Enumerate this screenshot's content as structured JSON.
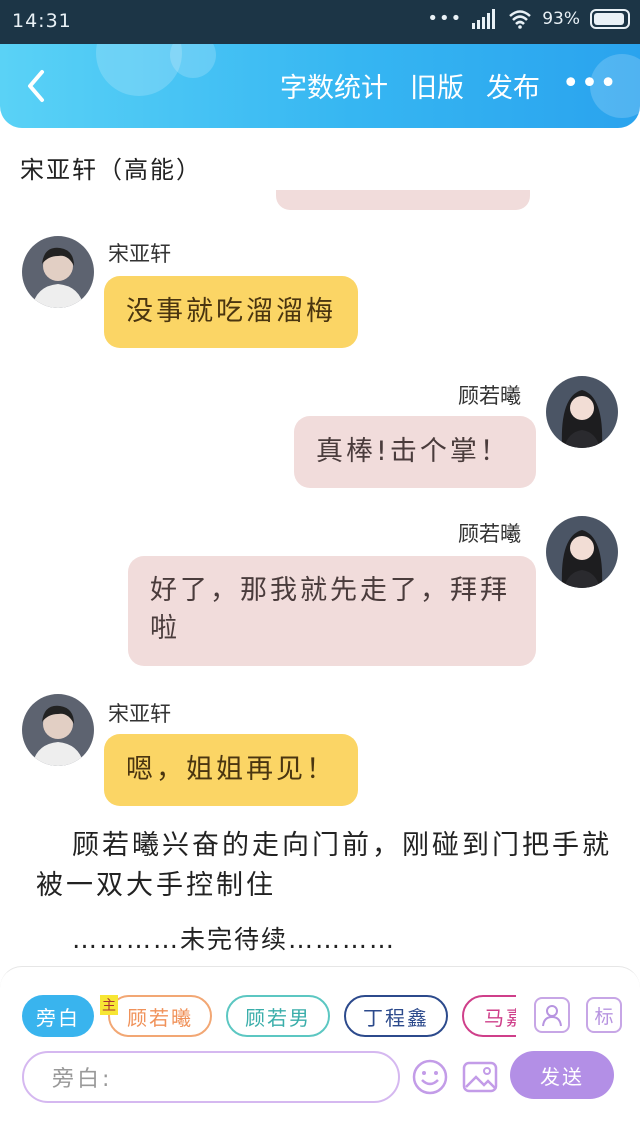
{
  "status_bar": {
    "time": "14:31",
    "battery": "93%",
    "battery_level": 0.93
  },
  "header": {
    "actions": [
      "字数统计",
      "旧版",
      "发布"
    ],
    "more": "•••"
  },
  "story_title": "宋亚轩（高能）",
  "messages": [
    {
      "side": "left",
      "name": "宋亚轩",
      "text": "没事就吃溜溜梅"
    },
    {
      "side": "right",
      "name": "顾若曦",
      "text": "真棒!击个掌！"
    },
    {
      "side": "right",
      "name": "顾若曦",
      "text": "好了，那我就先走了，拜拜啦"
    },
    {
      "side": "left",
      "name": "宋亚轩",
      "text": "嗯，姐姐再见！"
    }
  ],
  "narration": "顾若曦兴奋的走向门前，刚碰到门把手就被一双大手控制住",
  "to_be_continued": "…………未完待续…………",
  "panel": {
    "chips": [
      "旁白",
      "顾若曦",
      "顾若男",
      "丁程鑫",
      "马嘉"
    ],
    "chip_badge": "主",
    "side_icons": {
      "role_icon": "person-icon",
      "mark_label": "标"
    },
    "input_placeholder": "旁白:",
    "send_label": "发送"
  },
  "colors": {
    "header_start": "#5ad2f6",
    "header_end": "#2aa3ee",
    "left_bubble": "#fbd565",
    "right_bubble": "#f1dcdb",
    "send": "#b38fe6"
  }
}
